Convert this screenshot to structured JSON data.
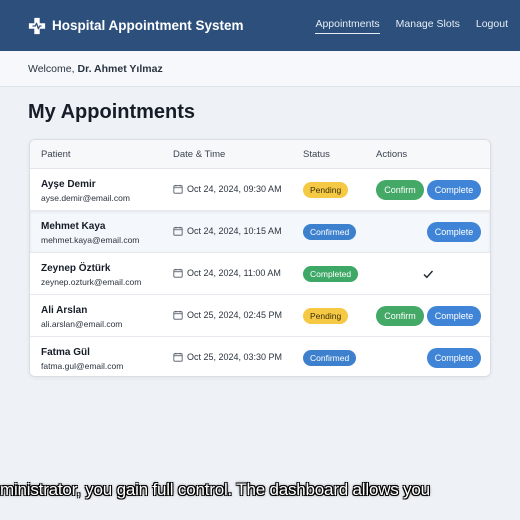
{
  "header": {
    "app_title": "Hospital Appointment System",
    "nav": [
      {
        "label": "Appointments",
        "active": true
      },
      {
        "label": "Manage Slots",
        "active": false
      },
      {
        "label": "Logout",
        "active": false
      }
    ]
  },
  "welcome": {
    "prefix": "Welcome,",
    "name": "Dr. Ahmet Yılmaz"
  },
  "page_title": "My Appointments",
  "table": {
    "headers": {
      "patient": "Patient",
      "datetime": "Date & Time",
      "status": "Status",
      "actions": "Actions"
    },
    "rows": [
      {
        "name": "Ayşe Demir",
        "email": "ayse.demir@email.com",
        "datetime": "Oct 24, 2024, 09:30 AM",
        "status": "Pending",
        "confirm": "Confirm",
        "complete": "Complete"
      },
      {
        "name": "Mehmet Kaya",
        "email": "mehmet.kaya@email.com",
        "datetime": "Oct 24, 2024, 10:15 AM",
        "status": "Confirmed",
        "complete": "Complete"
      },
      {
        "name": "Zeynep Öztürk",
        "email": "zeynep.ozturk@email.com",
        "datetime": "Oct 24, 2024, 11:00 AM",
        "status": "Completed"
      },
      {
        "name": "Ali Arslan",
        "email": "ali.arslan@email.com",
        "datetime": "Oct 25, 2024, 02:45 PM",
        "status": "Pending",
        "confirm": "Confirm",
        "complete": "Complete"
      },
      {
        "name": "Fatma Gül",
        "email": "fatma.gul@email.com",
        "datetime": "Oct 25, 2024, 03:30 PM",
        "status": "Confirmed",
        "complete": "Complete"
      }
    ]
  },
  "caption": "ministrator, you gain full control. The dashboard allows you",
  "colors": {
    "header_bg": "#2c4f7c",
    "pending": "#f6c945",
    "confirmed": "#3d80cd",
    "completed": "#3ea866",
    "confirm_button": "#44a866",
    "complete_button": "#3f84d6"
  },
  "icons": {
    "logo": "medical-cross-icon",
    "date": "calendar-icon",
    "done": "check-icon"
  }
}
